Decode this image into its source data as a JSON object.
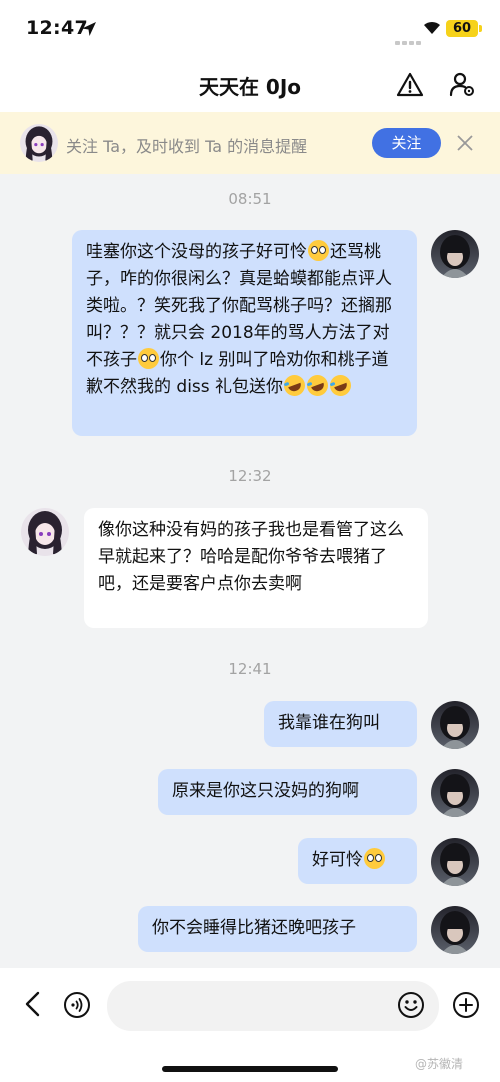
{
  "status": {
    "time": "12:47",
    "battery": "60"
  },
  "header": {
    "title": "天天在 0Jo"
  },
  "banner": {
    "text": "关注 Ta，及时收到 Ta 的消息提醒",
    "follow_label": "关注"
  },
  "messages": [
    {
      "type": "timestamp",
      "text": "08:51"
    },
    {
      "type": "outgoing",
      "segments": [
        "哇塞你这个没母的孩子好可怜",
        "还骂桃子，咋的你很闲么？真是蛤蟆都能点评人类啦。？笑死我了你配骂桃子吗？还搁那叫？？？就只会 2018年的骂人方法了对不孩子",
        "你个 lz 别叫了哈劝你和桃子道歉不然我的 diss 礼包送你"
      ]
    },
    {
      "type": "timestamp",
      "text": "12:32"
    },
    {
      "type": "incoming",
      "text": "像你这种没有妈的孩子我也是看管了这么早就起来了？哈哈是配你爷爷去喂猪了吧，还是要客户点你去卖啊"
    },
    {
      "type": "timestamp",
      "text": "12:41"
    },
    {
      "type": "outgoing",
      "text": "我靠谁在狗叫"
    },
    {
      "type": "outgoing",
      "text": "原来是你这只没妈的狗啊"
    },
    {
      "type": "outgoing",
      "text": "好可怜"
    },
    {
      "type": "outgoing",
      "text": "你不会睡得比猪还晚吧孩子"
    }
  ],
  "emoji": {
    "pleading": "pleading-face",
    "rofl": "rolling-on-floor-laughing"
  },
  "input": {
    "placeholder": ""
  },
  "watermark": "@苏徽清",
  "colors": {
    "accent": "#4171e3",
    "outgoing_bubble": "#cfe0fd",
    "banner_bg": "#fdf6dc"
  }
}
